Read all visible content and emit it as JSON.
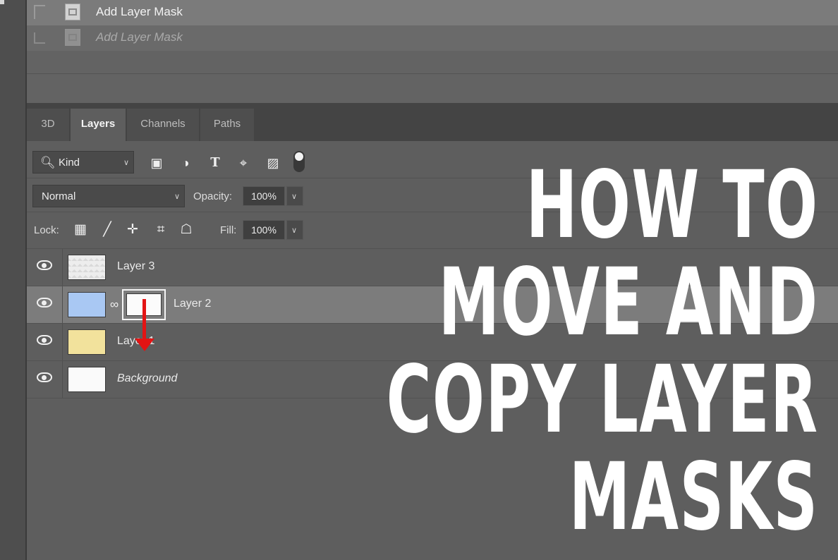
{
  "history": {
    "items": [
      {
        "label": "Add Layer Mask",
        "state": "active"
      },
      {
        "label": "Add Layer Mask",
        "state": "dimmed"
      }
    ]
  },
  "panel_tabs": [
    "3D",
    "Layers",
    "Channels",
    "Paths"
  ],
  "active_tab": "Layers",
  "filter": {
    "kind_label": "Kind",
    "icons": [
      "image-filter-icon",
      "adjustment-filter-icon",
      "type-filter-icon",
      "shape-filter-icon",
      "smart-object-filter-icon"
    ]
  },
  "blend": {
    "mode": "Normal",
    "opacity_label": "Opacity:",
    "opacity_value": "100%"
  },
  "lock": {
    "label": "Lock:",
    "icons": [
      "lock-transparent-pixels-icon",
      "lock-image-pixels-icon",
      "lock-position-icon",
      "lock-artboard-icon",
      "lock-all-icon"
    ],
    "fill_label": "Fill:",
    "fill_value": "100%"
  },
  "layers": [
    {
      "name": "Layer 3",
      "thumb": "transparent",
      "visible": true,
      "selected": false
    },
    {
      "name": "Layer 2",
      "thumb": "blue",
      "visible": true,
      "selected": true,
      "has_mask": true
    },
    {
      "name": "Layer 1",
      "thumb": "yellow",
      "visible": true,
      "selected": false
    },
    {
      "name": "Background",
      "thumb": "white",
      "visible": true,
      "selected": false,
      "italic": true
    }
  ],
  "headline": [
    "HOW TO",
    "MOVE AND",
    "COPY LAYER",
    "MASKS"
  ],
  "colors": {
    "panel_bg": "#5e5e5e",
    "selected_row": "#7c7c7c",
    "arrow": "#e31414",
    "headline": "#ffffff"
  }
}
